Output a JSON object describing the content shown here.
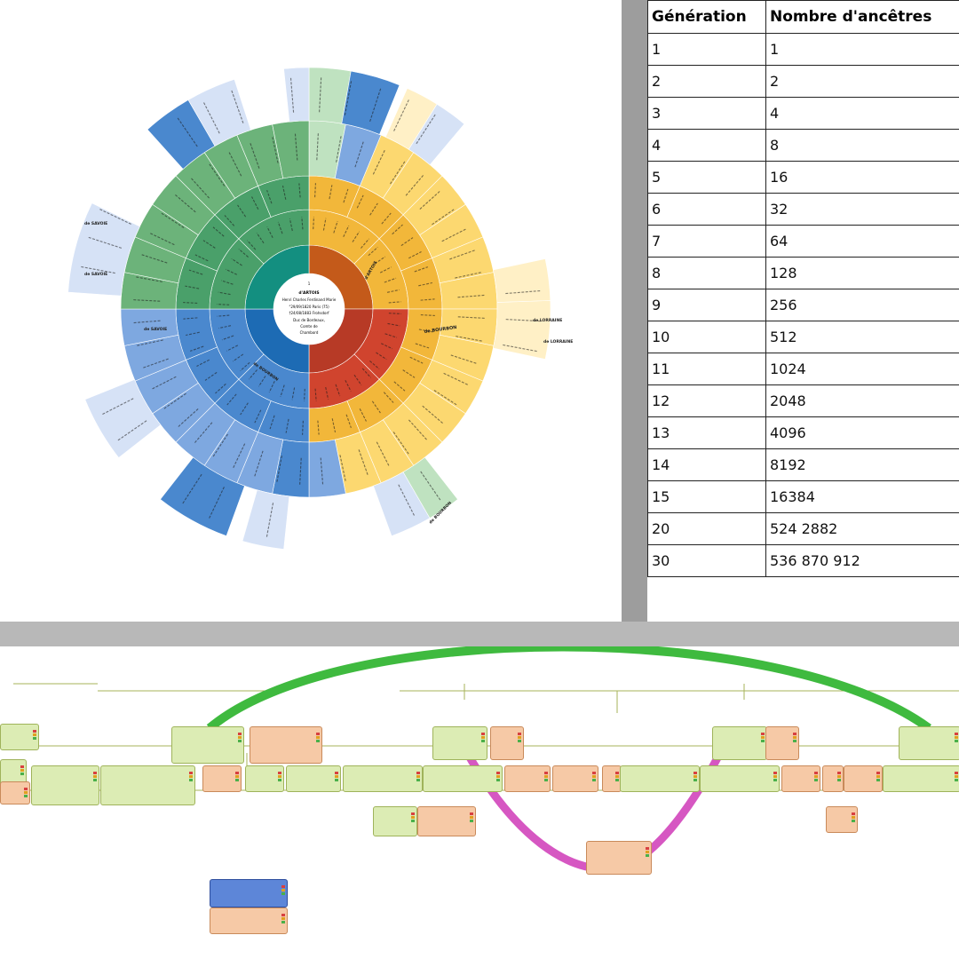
{
  "table": {
    "headers": [
      "Génération",
      "Nombre d'ancêtres"
    ],
    "rows": [
      [
        "1",
        "1"
      ],
      [
        "2",
        "2"
      ],
      [
        "3",
        "4"
      ],
      [
        "4",
        "8"
      ],
      [
        "5",
        "16"
      ],
      [
        "6",
        "32"
      ],
      [
        "7",
        "64"
      ],
      [
        "8",
        "128"
      ],
      [
        "9",
        "256"
      ],
      [
        "10",
        "512"
      ],
      [
        "11",
        "1024"
      ],
      [
        "12",
        "2048"
      ],
      [
        "13",
        "4096"
      ],
      [
        "14",
        "8192"
      ],
      [
        "15",
        "16384"
      ],
      [
        "20",
        "524 2882"
      ],
      [
        "30",
        "536 870 912"
      ]
    ]
  },
  "fan_chart": {
    "center": {
      "number": "1",
      "family": "d'ARTOIS",
      "name": "Henri Charles Ferdinand Marie",
      "birth": "°29/09/1820 Paris (75)",
      "death": "†24/08/1883 Frohsdorf",
      "titles": [
        "Duc de Bordeaux,",
        "Comte de",
        "Chambord"
      ]
    },
    "labels": {
      "n4": "d'ARTOIS",
      "n13": "de BOURBON",
      "n18": "de BOURBON",
      "n18b": "de BOURBON",
      "n32": "de LORRAINE",
      "n38": "de LORRAINE",
      "n43": "de SAVOIE",
      "n44": "de SAVOIE",
      "n47": "de SAVOIE"
    },
    "colors": {
      "green_inner": "#138f80",
      "green_mid": "#4aa06a",
      "green_outer": "#6cb37a",
      "green_pale": "#bfe2c0",
      "orange_inner": "#c45a1a",
      "orange_mid": "#f2b73a",
      "orange_outer": "#fcd870",
      "yellow_pale": "#fff0c6",
      "red_inner": "#b73a26",
      "red_mid": "#d0442e",
      "blue_inner": "#1d6bb4",
      "blue_mid": "#4a88ce",
      "blue_outer": "#7ea8e0",
      "blue_pale": "#d6e2f6"
    }
  },
  "tree": {
    "highlight_colors": {
      "green_arc": "#3fba3f",
      "pink_arc": "#d657c2"
    }
  }
}
